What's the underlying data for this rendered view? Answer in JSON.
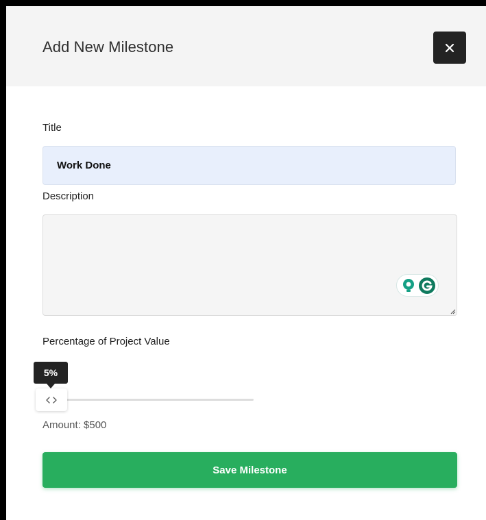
{
  "modal": {
    "title": "Add New Milestone",
    "close_icon": "close-icon"
  },
  "form": {
    "title_label": "Title",
    "title_value": "Work Done",
    "description_label": "Description",
    "description_value": "",
    "percentage_label": "Percentage of Project Value",
    "percentage_value": 5,
    "percentage_tooltip": "5%",
    "amount_text": "Amount: $500",
    "save_label": "Save Milestone"
  },
  "grammarly_widget": {
    "icons": [
      "lightbulb-icon",
      "grammarly-g-icon"
    ]
  },
  "colors": {
    "header_bg": "#f4f4f4",
    "close_button_bg": "#232323",
    "title_input_bg": "#e8effc",
    "save_button_bg": "#28ae5e",
    "grammarly_teal": "#15a085",
    "grammarly_green": "#0f7a5e"
  }
}
